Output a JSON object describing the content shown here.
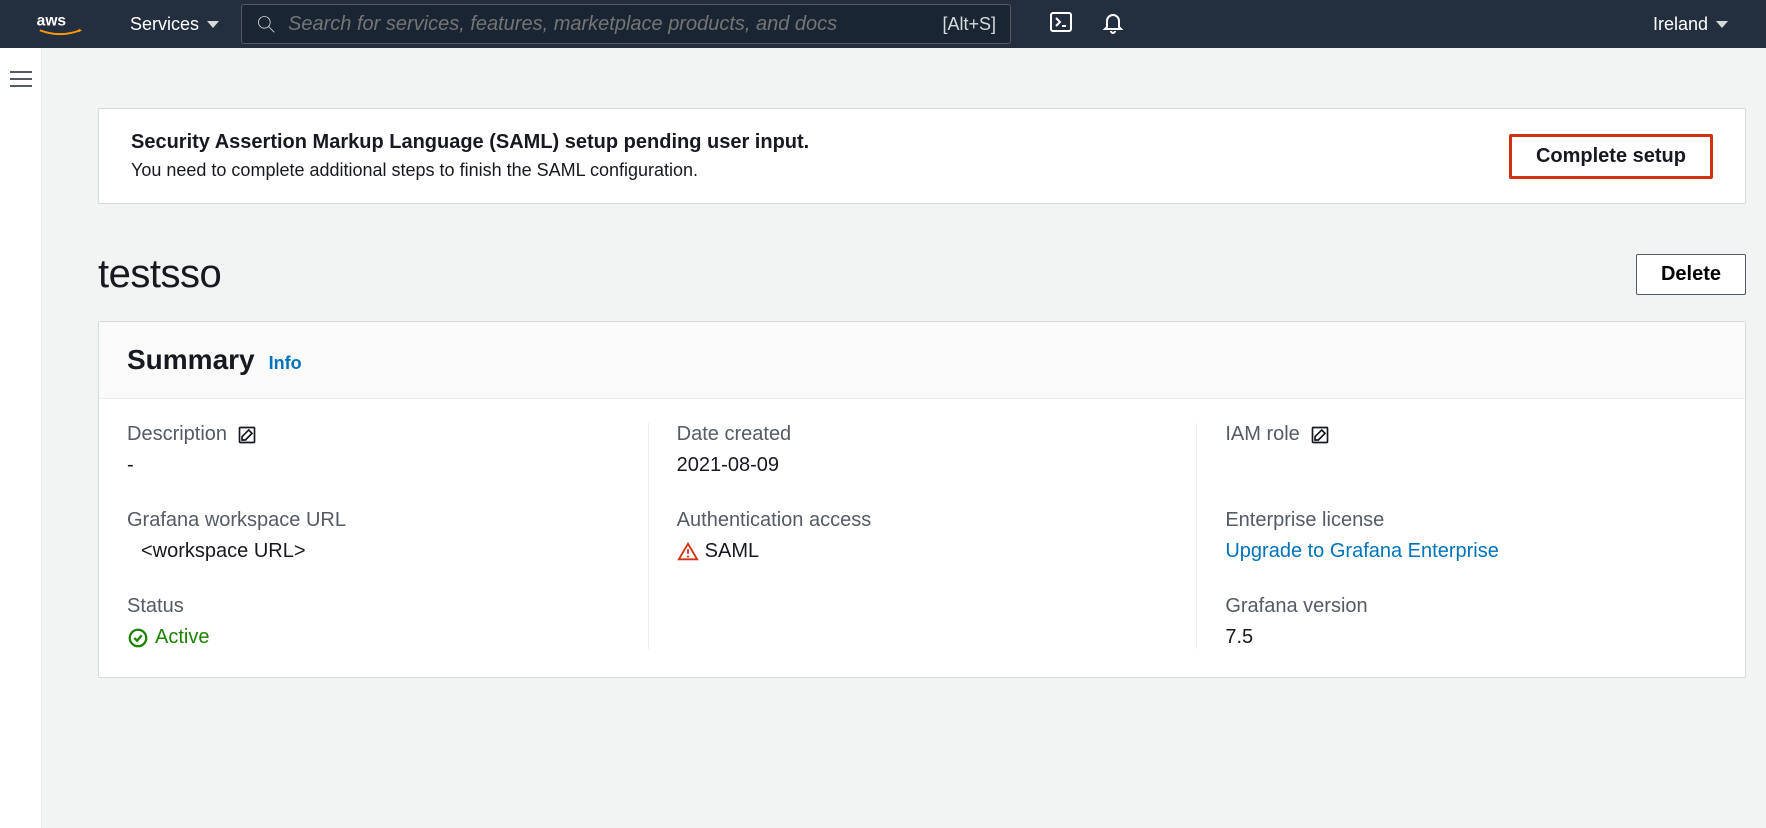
{
  "nav": {
    "services_label": "Services",
    "search_placeholder": "Search for services, features, marketplace products, and docs",
    "search_shortcut": "[Alt+S]",
    "region": "Ireland"
  },
  "alert": {
    "title": "Security Assertion Markup Language (SAML) setup pending user input.",
    "body": "You need to complete additional steps to finish the SAML configuration.",
    "action_label": "Complete setup"
  },
  "page": {
    "title": "testsso",
    "delete_label": "Delete"
  },
  "summary": {
    "heading": "Summary",
    "info_label": "Info",
    "description_label": "Description",
    "description_value": "-",
    "workspace_url_label": "Grafana workspace URL",
    "workspace_url_value": "<workspace URL>",
    "status_label": "Status",
    "status_value": "Active",
    "date_created_label": "Date created",
    "date_created_value": "2021-08-09",
    "auth_label": "Authentication access",
    "auth_value": "SAML",
    "iam_label": "IAM role",
    "enterprise_label": "Enterprise license",
    "enterprise_link": "Upgrade to Grafana Enterprise",
    "version_label": "Grafana version",
    "version_value": "7.5"
  }
}
